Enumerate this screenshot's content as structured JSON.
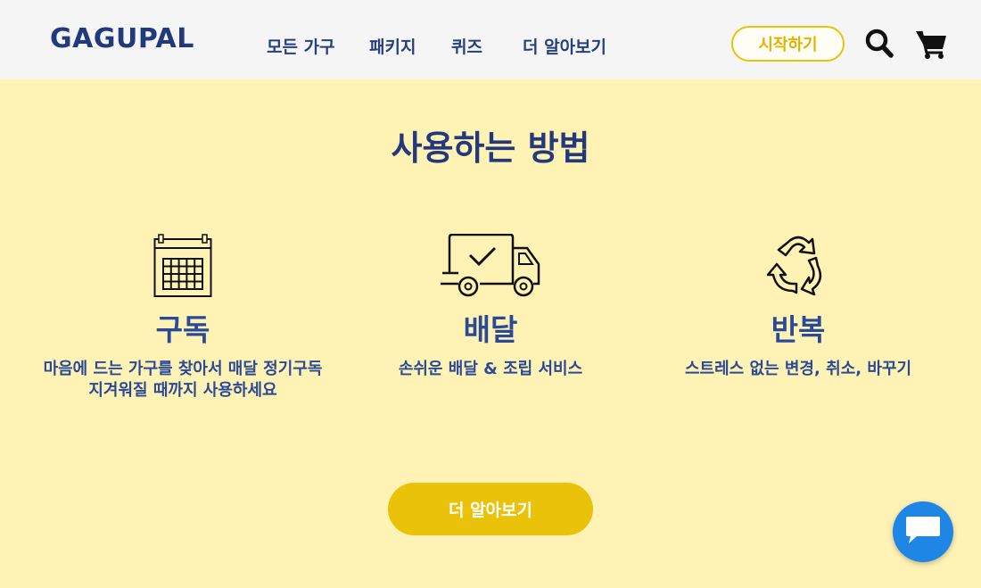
{
  "header": {
    "logo": "GAGUPAL",
    "nav": [
      "모든 가구",
      "패키지",
      "퀴즈",
      "더 알아보기"
    ],
    "start_button": "시작하기",
    "icons": {
      "search": "search-icon",
      "cart": "cart-icon"
    }
  },
  "main": {
    "title": "사용하는 방법",
    "steps": [
      {
        "icon": "calendar-icon",
        "title": "구독",
        "desc_line1": "마음에 드는 가구를 찾아서 매달 정기구독",
        "desc_line2": "지겨워질 때까지 사용하세요"
      },
      {
        "icon": "delivery-truck-icon",
        "title": "배달",
        "desc_line1": "손쉬운 배달 & 조립 서비스",
        "desc_line2": ""
      },
      {
        "icon": "recycle-icon",
        "title": "반복",
        "desc_line1": "스트레스 없는 변경, 취소, 바꾸기",
        "desc_line2": ""
      }
    ],
    "learn_more_button": "더 알아보기"
  },
  "chat": {
    "icon": "chat-bubble-icon"
  },
  "colors": {
    "brand_navy": "#223a7c",
    "accent_yellow": "#ebc20a",
    "section_bg": "#fff2b5",
    "chat_blue": "#1e86e5"
  }
}
